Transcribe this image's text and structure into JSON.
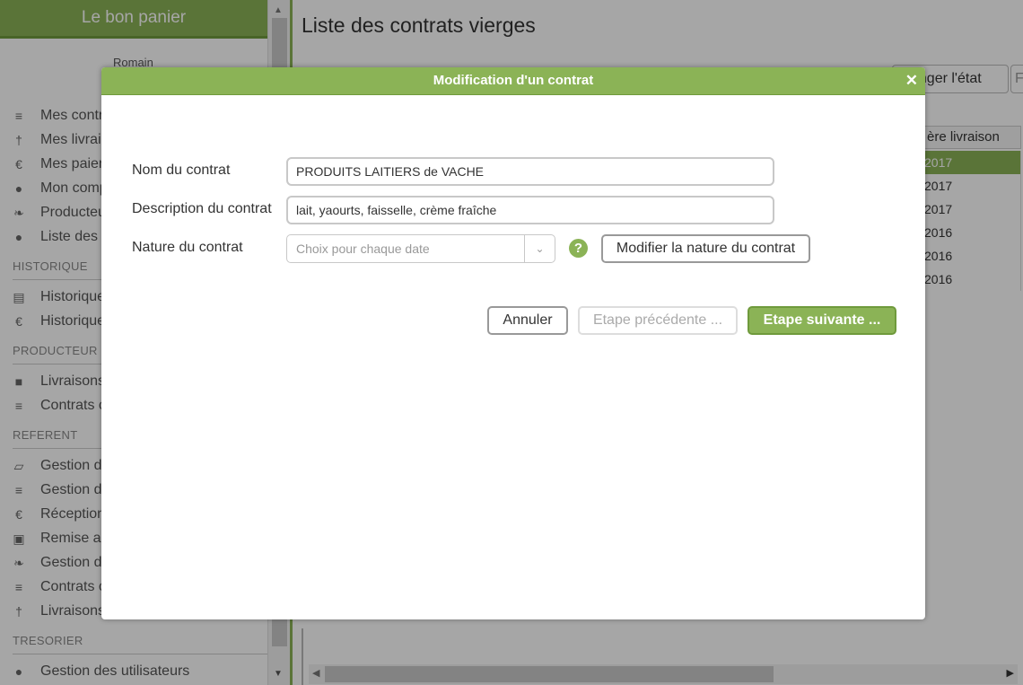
{
  "app": {
    "title": "Le bon panier",
    "user": "Romain"
  },
  "sidebar": {
    "items_top": [
      {
        "icon": "document-icon",
        "glyph": "≡",
        "label": "Mes contr"
      },
      {
        "icon": "cutlery-icon",
        "glyph": "†",
        "label": "Mes livrai"
      },
      {
        "icon": "euro-icon",
        "glyph": "€",
        "label": "Mes paier"
      },
      {
        "icon": "user-icon",
        "glyph": "●",
        "label": "Mon comp"
      },
      {
        "icon": "leaf-icon",
        "glyph": "❧",
        "label": "Producteu"
      },
      {
        "icon": "users-icon",
        "glyph": "●",
        "label": "Liste des"
      }
    ],
    "section_historique": "HISTORIQUE",
    "items_historique": [
      {
        "icon": "book-icon",
        "glyph": "▤",
        "label": "Historique"
      },
      {
        "icon": "euro-icon",
        "glyph": "€",
        "label": "Historique"
      }
    ],
    "section_producteur": "PRODUCTEUR",
    "items_producteur": [
      {
        "icon": "truck-icon",
        "glyph": "■",
        "label": "Livraisons"
      },
      {
        "icon": "document-icon",
        "glyph": "≡",
        "label": "Contrats c"
      }
    ],
    "section_referent": "REFERENT",
    "items_referent": [
      {
        "icon": "folder-open-icon",
        "glyph": "▱",
        "label": "Gestion d"
      },
      {
        "icon": "document-icon",
        "glyph": "≡",
        "label": "Gestion d"
      },
      {
        "icon": "euro-icon",
        "glyph": "€",
        "label": "Réception"
      },
      {
        "icon": "money-icon",
        "glyph": "▣",
        "label": "Remise a"
      },
      {
        "icon": "leaf-icon",
        "glyph": "❧",
        "label": "Gestion d"
      },
      {
        "icon": "document-icon",
        "glyph": "≡",
        "label": "Contrats c"
      },
      {
        "icon": "cutlery-icon",
        "glyph": "†",
        "label": "Livraisons"
      }
    ],
    "section_tresorier": "TRESORIER",
    "items_tresorier": [
      {
        "icon": "users-icon",
        "glyph": "●",
        "label": "Gestion des utilisateurs"
      }
    ]
  },
  "main": {
    "title": "Liste des contrats vierges",
    "toolbar_change_state": "anger l'état",
    "toolbar_next": "F",
    "table_header": "ère livraison",
    "table_cells": [
      "2017",
      "2017",
      "2017",
      "2016",
      "2016",
      "2016"
    ]
  },
  "dialog": {
    "title": "Modification d'un contrat",
    "close_glyph": "✕",
    "name_label": "Nom du contrat",
    "name_value": "PRODUITS LAITIERS de VACHE",
    "description_label": "Description du contrat",
    "description_value": "lait, yaourts, faisselle, crème fraîche",
    "nature_label": "Nature du contrat",
    "nature_value": "Choix pour chaque date",
    "help_glyph": "?",
    "modify_nature_label": "Modifier la nature du contrat",
    "cancel_label": "Annuler",
    "previous_label": "Etape précédente ...",
    "next_label": "Etape suivante ..."
  },
  "colors": {
    "accent": "#8bb356",
    "accent_dark": "#6f9a3c"
  }
}
